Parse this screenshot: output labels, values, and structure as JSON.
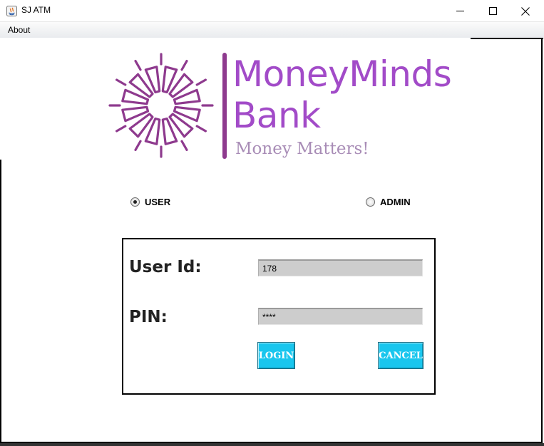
{
  "window": {
    "title": "SJ ATM",
    "controls": [
      "minimize",
      "maximize",
      "close"
    ]
  },
  "menu": {
    "items": [
      "About"
    ]
  },
  "logo": {
    "name_line1": "MoneyMinds",
    "name_line2": "Bank",
    "tagline": "Money Matters!",
    "colors": {
      "primary": "#a24bc8",
      "mark": "#8e3a8e",
      "tagline": "#a88cb6"
    }
  },
  "role": {
    "options": [
      "USER",
      "ADMIN"
    ],
    "selected": "USER"
  },
  "form": {
    "user_id_label": "User Id:",
    "user_id_value": "178",
    "pin_label": "PIN:",
    "pin_value": "****",
    "login_button": "LOGIN",
    "cancel_button": "CANCEL"
  },
  "colors": {
    "button": "#19c6ee",
    "field_background": "#cdcdcd"
  }
}
